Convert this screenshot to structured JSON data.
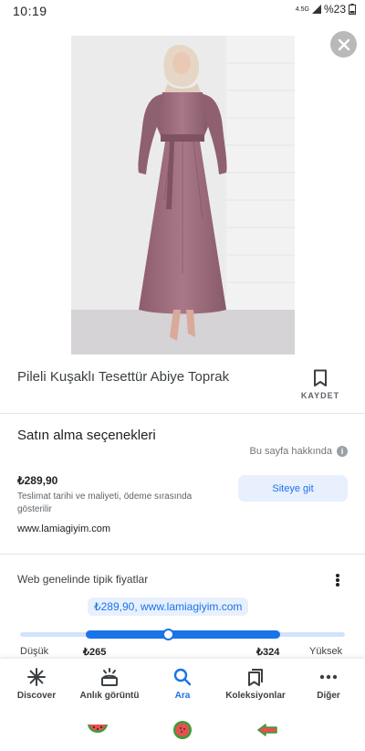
{
  "status_bar": {
    "time": "10:19",
    "network": "4.5G",
    "battery": "%23"
  },
  "product": {
    "title": "Pileli Kuşaklı Tesettür Abiye Toprak",
    "save_label": "KAYDET",
    "dress_color": "#9b6b7c"
  },
  "purchase": {
    "section_title": "Satın alma seçenekleri",
    "about_link": "Bu sayfa hakkında",
    "price": "₺289,90",
    "shipping_note": "Teslimat tarihi ve maliyeti, ödeme sırasında gösterilir",
    "visit_button": "Siteye git",
    "domain": "www.lamiagiyim.com"
  },
  "typical_prices": {
    "title": "Web genelinde tipik fiyatlar",
    "bubble": "₺289,90, www.lamiagiyim.com",
    "low_label": "Düşük",
    "low_value": "₺265",
    "high_value": "₺324",
    "high_label": "Yüksek"
  },
  "bottom_nav": {
    "items": [
      {
        "label": "Discover",
        "icon": "asterisk-icon"
      },
      {
        "label": "Anlık görüntü",
        "icon": "snapshot-icon"
      },
      {
        "label": "Ara",
        "icon": "search-icon"
      },
      {
        "label": "Koleksiyonlar",
        "icon": "collections-icon"
      },
      {
        "label": "Diğer",
        "icon": "more-horizontal-icon"
      }
    ],
    "active_color": "#1a73e8"
  },
  "colors": {
    "accent": "#1a73e8",
    "accent_light": "#e8f0fe",
    "text_primary": "#202124",
    "text_secondary": "#5f6368"
  }
}
